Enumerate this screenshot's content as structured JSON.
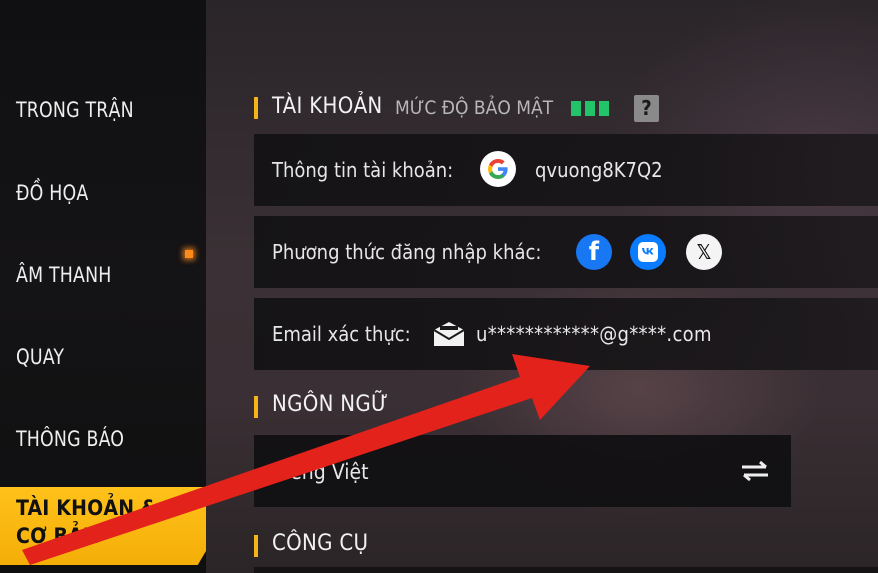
{
  "sidebar": {
    "items": [
      {
        "label": "TRONG TRẬN"
      },
      {
        "label": "ĐỒ HỌA"
      },
      {
        "label": "ÂM THANH"
      },
      {
        "label": "QUAY"
      },
      {
        "label": "THÔNG BÁO"
      },
      {
        "label": "TÀI KHOẢN & CƠ BẢN",
        "active": true
      }
    ]
  },
  "account": {
    "title": "TÀI KHOẢN",
    "security_label": "MỨC ĐỘ BẢO MẬT",
    "security_level": "3/3",
    "help": "?",
    "info_label": "Thông tin tài khoản:",
    "username": "qvuong8K7Q2",
    "other_login_label": "Phương thức đăng nhập khác:",
    "login_methods": [
      "facebook-icon",
      "vk-icon",
      "x-icon"
    ],
    "email_label": "Email xác thực:",
    "email": "u************@g****.com"
  },
  "language": {
    "title": "NGÔN NGỮ",
    "value": "Tiếng Việt"
  },
  "tools": {
    "title": "CÔNG CỤ"
  },
  "colors": {
    "accent": "#f7b31a",
    "security": "#23c36a",
    "annotation_arrow": "#e3221b"
  }
}
